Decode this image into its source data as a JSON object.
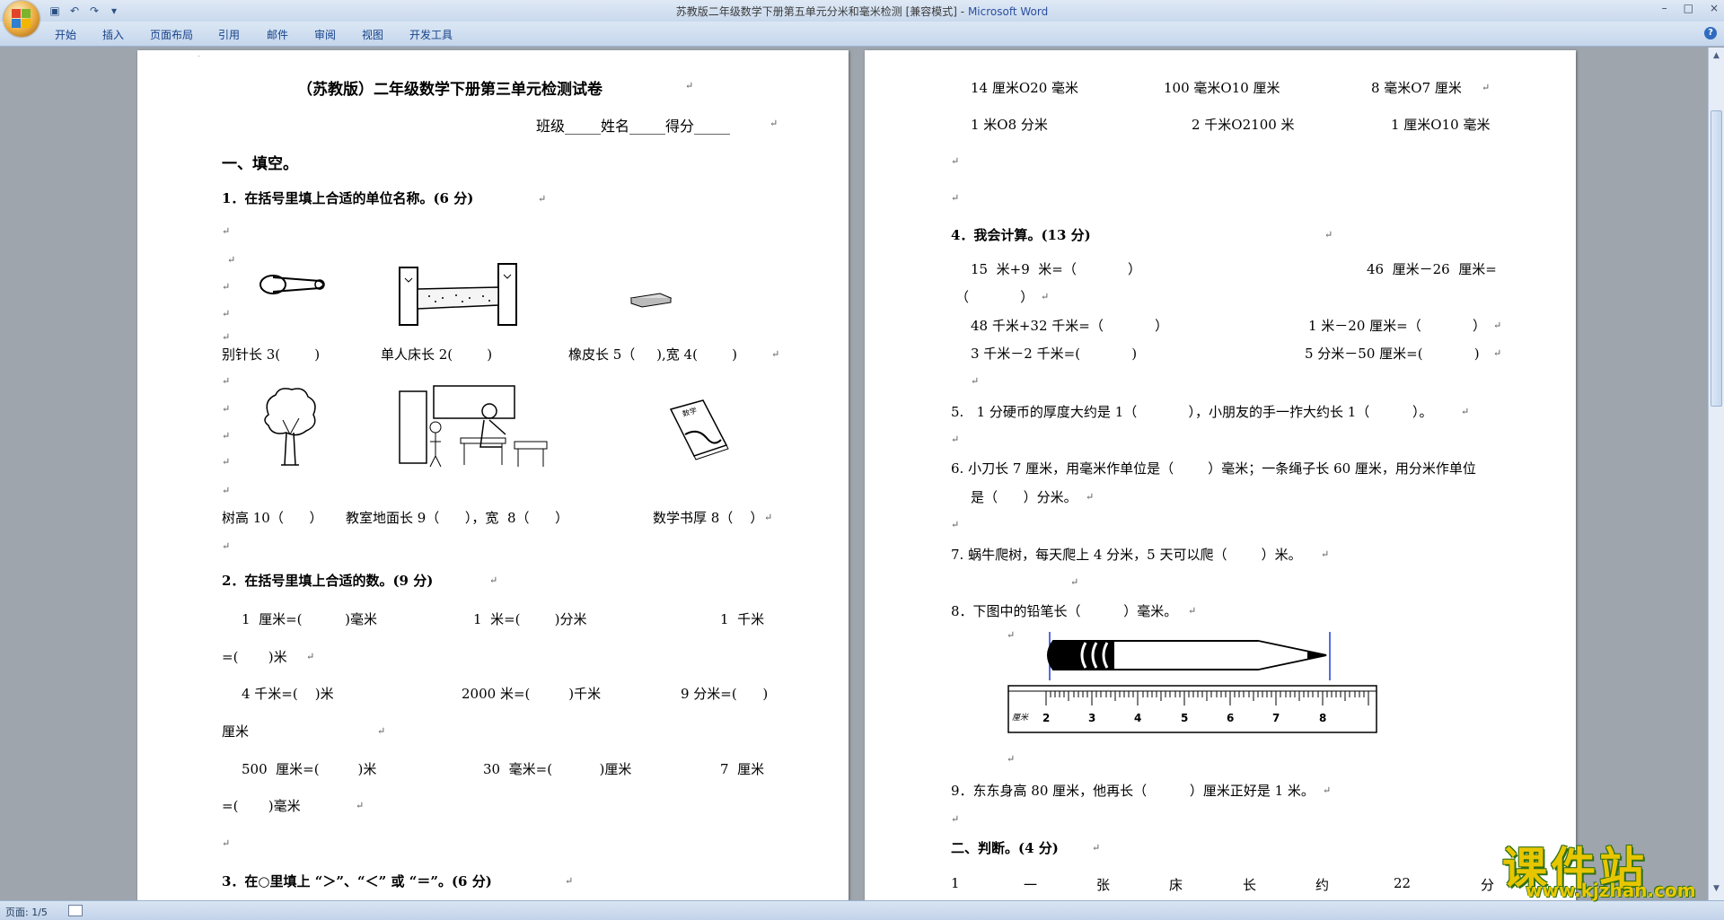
{
  "window": {
    "title": "苏教版二年级数学下册第五单元分米和毫米检测 [兼容模式]",
    "app_name": "Microsoft Word",
    "controls": [
      "–",
      "□",
      "×"
    ]
  },
  "qat": {
    "icons": [
      "save-icon",
      "undo-icon",
      "redo-icon",
      "customize-icon"
    ]
  },
  "menu": {
    "tabs": [
      "开始",
      "插入",
      "页面布局",
      "引用",
      "邮件",
      "审阅",
      "视图",
      "开发工具"
    ]
  },
  "page1": {
    "title": "（苏教版）二年级数学下册第三单元检测试卷",
    "info": "班级_____姓名_____得分_____",
    "sec1": "一、填空。",
    "q1": "1．在括号里填上合适的单位名称。(6 分)",
    "row1": {
      "a": "别针长 3(        )",
      "b": "单人床长 2(        )",
      "c": "橡皮长 5（     ),宽 4(        )"
    },
    "row2": {
      "a": "树高 10（      ）",
      "b": "教室地面长 9（      ），宽  8（      ）",
      "c": "数学书厚 8（    ）"
    },
    "q2": "2．在括号里填上合适的数。(9 分)",
    "q2_lines": [
      "1  厘米=(          )毫米",
      "1  米=(        )分米",
      "1  千米",
      "=(       )米",
      "4 千米=(    )米",
      "2000 米=(         )千米",
      "9 分米=(      )",
      "厘米",
      "500  厘米=(         )米",
      "30  毫米=(           )厘米",
      "7  厘米",
      "=(       )毫米"
    ],
    "q3": "3．在○里填上 “＞”、“＜” 或 “＝”。(6 分)",
    "math_book_label": "数学"
  },
  "page2": {
    "cmp": [
      "14 厘米O20 毫米",
      "100 毫米O10 厘米",
      "8 毫米O7 厘米",
      "1 米O8 分米",
      "2 千米O2100 米",
      "1 厘米O10 毫米"
    ],
    "q4": "4．我会计算。(13 分)",
    "calc": [
      "15  米+9  米=（            ）",
      "46  厘米－26  厘米=",
      "（            ）",
      "48 千米+32 千米=（            ）",
      "1 米－20 厘米=（            ）",
      "3 千米－2 千米=(            )",
      "5 分米－50 厘米=(            )"
    ],
    "q5": "5.   1 分硬币的厚度大约是 1（            ），小朋友的手一拃大约长 1（          ）。",
    "q6a": "6. 小刀长 7 厘米，用毫米作单位是（        ）毫米；一条绳子长 60 厘米，用分米作单位",
    "q6b": "是（      ）分米。",
    "q7": "7. 蜗牛爬树，每天爬上 4 分米，5 天可以爬（        ）米。",
    "q8": "8．下图中的铅笔长（          ）毫米。",
    "ruler_unit": "厘米",
    "ruler_nums": [
      "2",
      "3",
      "4",
      "5",
      "6",
      "7",
      "8"
    ],
    "q9": "9．东东身高 80 厘米，他再长（          ）厘米正好是 1 米。",
    "sec2": "二、判断。(4 分)",
    "judge": [
      "1",
      "一",
      "张",
      "床",
      "长",
      "约",
      "22",
      "分"
    ]
  },
  "status": {
    "page": "页面: 1/5"
  },
  "watermark": {
    "title": "课件站",
    "url": "www.kjzhan.com"
  },
  "return_mark": "↵"
}
